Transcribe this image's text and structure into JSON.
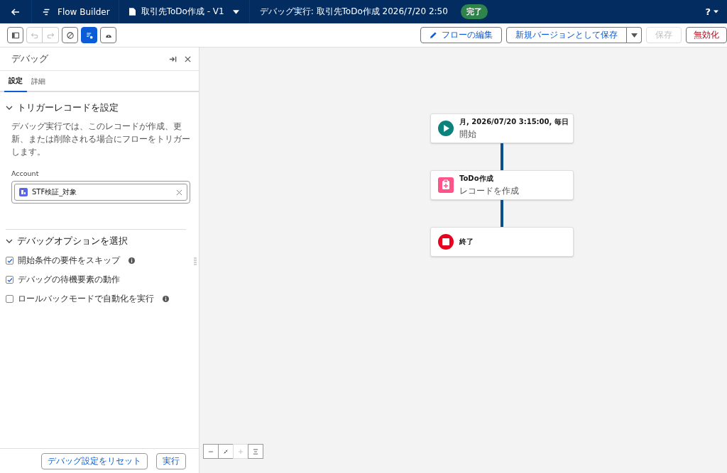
{
  "topbar": {
    "app_name": "Flow Builder",
    "flow_name": "取引先ToDo作成 - V1",
    "debug_title": "デバッグ実行: 取引先ToDo作成 2026/7/20 2:50",
    "status": "完了",
    "help": "?"
  },
  "toolbar": {
    "tools": [
      {
        "kind": "panel",
        "disabled": false,
        "selected": false
      },
      {
        "kind": "undo",
        "disabled": true,
        "selected": false
      },
      {
        "kind": "redo",
        "disabled": true,
        "selected": false
      },
      {
        "kind": "block",
        "disabled": false,
        "selected": false
      },
      {
        "kind": "debug",
        "disabled": false,
        "selected": true
      },
      {
        "kind": "bug",
        "disabled": false,
        "selected": false
      }
    ],
    "actions": [
      {
        "kind": "edit",
        "label": "フローの編集",
        "disabled": false
      },
      {
        "kind": "split",
        "label": "新規バージョンとして保存",
        "disabled": false
      },
      {
        "kind": "plain",
        "label": "保存",
        "disabled": true
      },
      {
        "kind": "danger",
        "label": "無効化",
        "disabled": false
      }
    ]
  },
  "panel": {
    "title": "デバッグ",
    "tabs": [
      {
        "label": "設定",
        "selected": true
      },
      {
        "label": "詳細",
        "selected": false
      }
    ],
    "trigger": {
      "title": "トリガーレコードを設定",
      "description": "デバッグ実行では、このレコードが作成、更新、または削除される場合にフローをトリガーします。",
      "field_label": "Account",
      "value": "STF検証_対象"
    },
    "options": {
      "title": "デバッグオプションを選択",
      "items": [
        {
          "label": "開始条件の要件をスキップ",
          "checked": true,
          "info": true
        },
        {
          "label": "デバッグの待機要素の動作",
          "checked": true,
          "info": false
        },
        {
          "label": "ロールバックモードで自動化を実行",
          "checked": false,
          "info": true
        }
      ]
    },
    "buttons": [
      "デバッグ設定をリセット",
      "実行"
    ]
  },
  "nodes": [
    {
      "kind": "start",
      "title": "月, 2026/07/20 3:15:00, 毎日",
      "subtitle": "開始"
    },
    {
      "kind": "create",
      "title": "ToDo作成",
      "subtitle": "レコードを作成"
    },
    {
      "kind": "end",
      "title": "終了"
    }
  ],
  "zoom_controls": [
    {
      "kind": "zoom-out",
      "disabled": false
    },
    {
      "kind": "fit",
      "disabled": false
    },
    {
      "kind": "zoom-in",
      "disabled": true
    },
    {
      "kind": "center",
      "disabled": false
    }
  ]
}
